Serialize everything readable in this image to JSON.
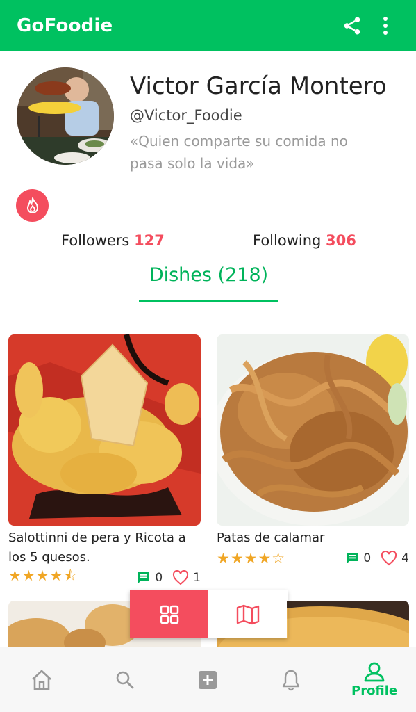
{
  "appbar": {
    "title": "GoFoodie",
    "share_icon": "share-icon",
    "menu_icon": "more-vert-icon"
  },
  "profile": {
    "name": "Victor García Montero",
    "handle": "@Victor_Foodie",
    "quote": "«Quien comparte su comida no pasa solo la vida»",
    "badge_icon": "fire-icon"
  },
  "stats": {
    "followers_label": "Followers",
    "followers_count": "127",
    "following_label": "Following",
    "following_count": "306"
  },
  "tabs": {
    "dishes": "Dishes (218)"
  },
  "dishes": [
    {
      "title": "Salottinni de pera y Ricota a los 5 quesos.",
      "rating": 4.5,
      "stars": "★★★★⯪",
      "comments": "0",
      "likes": "1"
    },
    {
      "title": "Patas de calamar",
      "rating": 4,
      "stars": "★★★★☆",
      "comments": "0",
      "likes": "4"
    }
  ],
  "view_toggle": {
    "grid_icon": "grid-icon",
    "map_icon": "map-icon",
    "active": "grid"
  },
  "bottom_nav": {
    "items": [
      "home-icon",
      "search-icon",
      "add-icon",
      "bell-icon",
      "profile-icon"
    ],
    "active_label": "Profile"
  },
  "colors": {
    "primary": "#00c160",
    "accent": "#f44d5e",
    "star": "#f0a625"
  }
}
